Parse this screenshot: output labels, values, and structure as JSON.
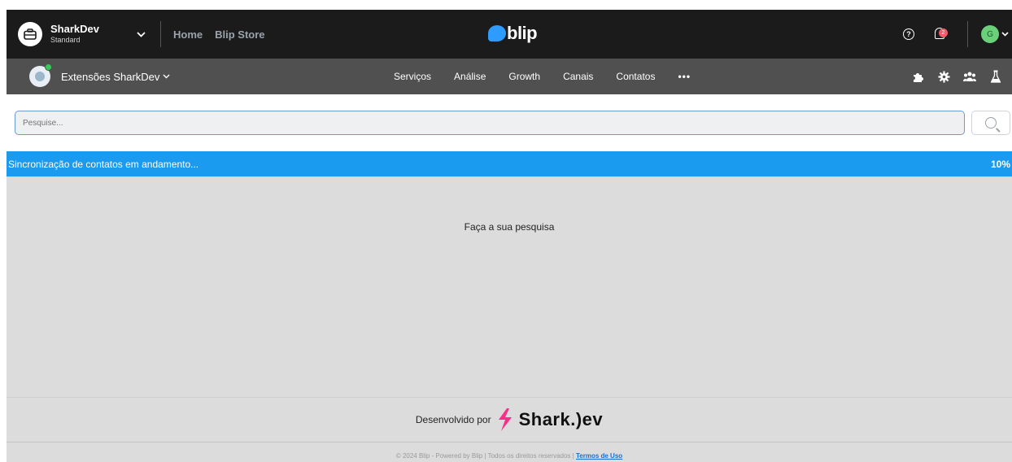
{
  "topbar": {
    "account_name": "SharkDev",
    "account_plan": "Standard",
    "links": [
      "Home",
      "Blip Store"
    ],
    "logo_text": "blip",
    "notification_count": "2",
    "user_initial": "G"
  },
  "subbar": {
    "bot_name": "Extensões SharkDev",
    "nav": [
      "Serviços",
      "Análise",
      "Growth",
      "Canais",
      "Contatos"
    ],
    "more_label": "•••",
    "icons": [
      "puzzle-icon",
      "gear-icon",
      "team-icon",
      "flask-icon"
    ]
  },
  "search": {
    "placeholder": "Pesquise..."
  },
  "sync": {
    "text": "Sincronização de contatos em andamento...",
    "progress_label": "10%",
    "progress": 0.1
  },
  "content": {
    "empty_message": "Faça a sua pesquisa"
  },
  "footer": {
    "developed_by": "Desenvolvido por",
    "brand": "Shark.)ev",
    "copyright": "© 2024 Blip - Powered by Blip | Todos os direitos reservados |",
    "terms_link": "Termos de Uso"
  },
  "colors": {
    "topbar_bg": "#1b1b1b",
    "subbar_bg": "#505050",
    "sync_bg": "#1a9bf0",
    "content_bg": "#dcdcdc",
    "brand_pink": "#ff2d8a",
    "blip_blue": "#2e9bff"
  }
}
